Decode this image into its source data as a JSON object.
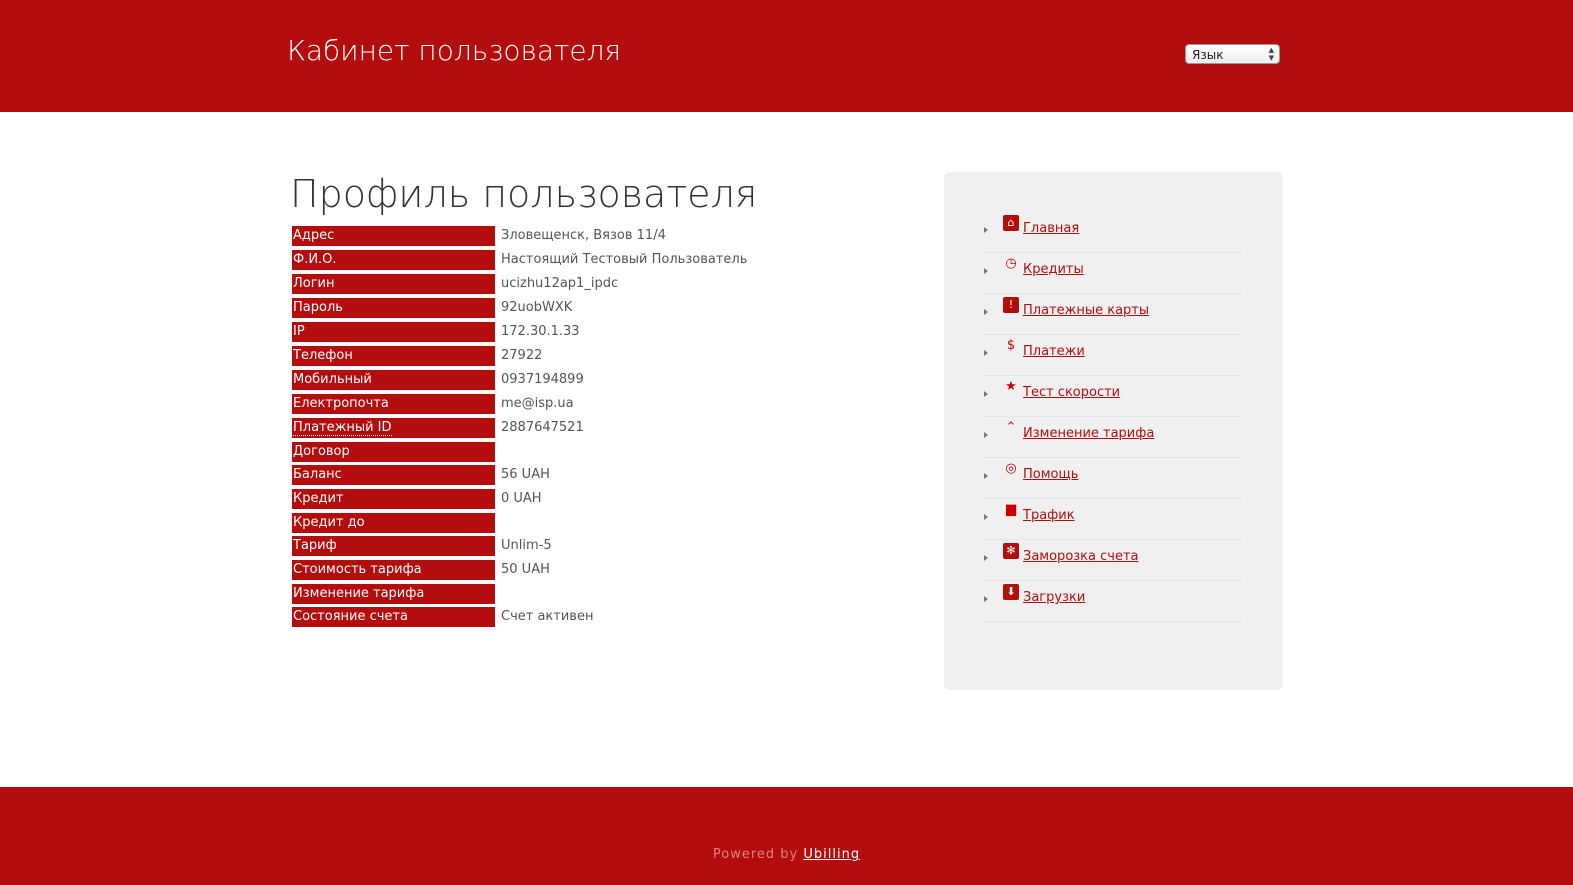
{
  "header": {
    "title": "Кабинет пользователя",
    "language_select": "Язык"
  },
  "main": {
    "title": "Профиль пользователя",
    "profile": [
      {
        "label": "Адрес",
        "value": "Зловещенск, Вязов 11/4"
      },
      {
        "label": "Ф.И.О.",
        "value": "Настоящий Тестовый Пользователь"
      },
      {
        "label": "Логин",
        "value": "ucizhu12ap1_ipdc"
      },
      {
        "label": "Пароль",
        "value": "92uobWXK"
      },
      {
        "label": "IP",
        "value": "172.30.1.33"
      },
      {
        "label": "Телефон",
        "value": "27922"
      },
      {
        "label": "Мобильный",
        "value": "0937194899"
      },
      {
        "label": "Електропочта",
        "value": "me@isp.ua"
      },
      {
        "label": "Платежный ID",
        "value": "2887647521"
      },
      {
        "label": "Договор",
        "value": ""
      },
      {
        "label": "Баланс",
        "value": "56 UAH"
      },
      {
        "label": "Кредит",
        "value": "0 UAH"
      },
      {
        "label": "Кредит до",
        "value": ""
      },
      {
        "label": "Тариф",
        "value": "Unlim-5"
      },
      {
        "label": "Стоимость тарифа",
        "value": "50 UAH"
      },
      {
        "label": "Изменение тарифа",
        "value": ""
      },
      {
        "label": "Состояние счета",
        "value": "Счет активен"
      }
    ]
  },
  "sidebar": {
    "items": [
      {
        "label": "Главная",
        "icon": "home-icon"
      },
      {
        "label": "Кредиты",
        "icon": "clock-icon"
      },
      {
        "label": "Платежные карты",
        "icon": "exclamation-icon"
      },
      {
        "label": "Платежи",
        "icon": "dollar-icon"
      },
      {
        "label": "Тест скорости",
        "icon": "star-icon"
      },
      {
        "label": "Изменение тарифа",
        "icon": "arrow-up-circle-icon"
      },
      {
        "label": "Помощь",
        "icon": "lifebuoy-icon"
      },
      {
        "label": "Трафик",
        "icon": "bar-chart-icon"
      },
      {
        "label": "Заморозка счета",
        "icon": "snowflake-icon"
      },
      {
        "label": "Загрузки",
        "icon": "download-icon"
      }
    ]
  },
  "footer": {
    "powered": "Powered by",
    "link": "Ubilling"
  },
  "colors": {
    "brand": "#b30d0d"
  }
}
